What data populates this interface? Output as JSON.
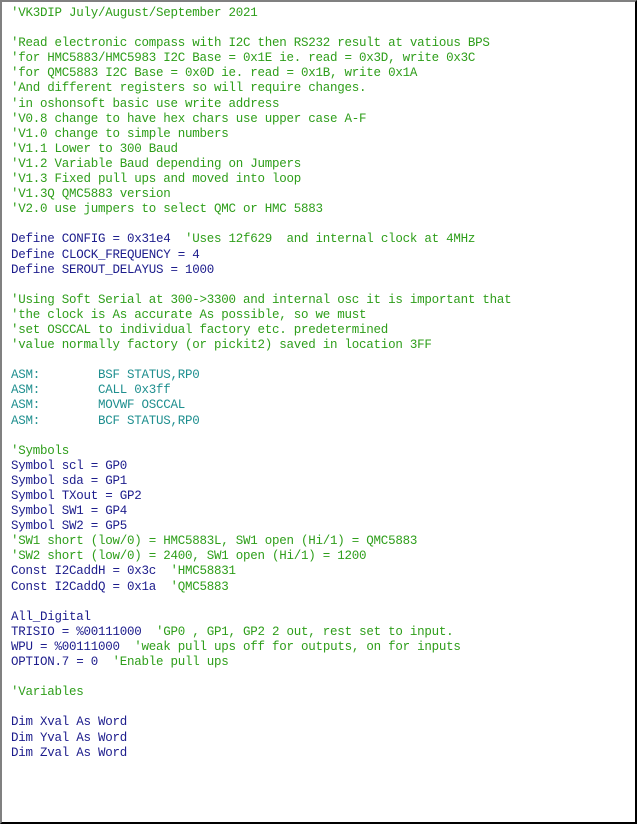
{
  "editor": {
    "colors": {
      "comment": "#2e9e1a",
      "code": "#1c1c8c",
      "asm": "#1f8f8f",
      "background": "#ffffff"
    },
    "lines": [
      [
        {
          "t": "comment",
          "v": "'VK3DIP July/August/September 2021"
        }
      ],
      [],
      [
        {
          "t": "comment",
          "v": "'Read electronic compass with I2C then RS232 result at vatious BPS"
        }
      ],
      [
        {
          "t": "comment",
          "v": "'for HMC5883/HMC5983 I2C Base = 0x1E ie. read = 0x3D, write 0x3C"
        }
      ],
      [
        {
          "t": "comment",
          "v": "'for QMC5883 I2C Base = 0x0D ie. read = 0x1B, write 0x1A"
        }
      ],
      [
        {
          "t": "comment",
          "v": "'And different registers so will require changes."
        }
      ],
      [
        {
          "t": "comment",
          "v": "'in oshonsoft basic use write address"
        }
      ],
      [
        {
          "t": "comment",
          "v": "'V0.8 change to have hex chars use upper case A-F"
        }
      ],
      [
        {
          "t": "comment",
          "v": "'V1.0 change to simple numbers"
        }
      ],
      [
        {
          "t": "comment",
          "v": "'V1.1 Lower to 300 Baud"
        }
      ],
      [
        {
          "t": "comment",
          "v": "'V1.2 Variable Baud depending on Jumpers"
        }
      ],
      [
        {
          "t": "comment",
          "v": "'V1.3 Fixed pull ups and moved into loop"
        }
      ],
      [
        {
          "t": "comment",
          "v": "'V1.3Q QMC5883 version"
        }
      ],
      [
        {
          "t": "comment",
          "v": "'V2.0 use jumpers to select QMC or HMC 5883"
        }
      ],
      [],
      [
        {
          "t": "code",
          "v": "Define CONFIG = 0x31e4  "
        },
        {
          "t": "comment",
          "v": "'Uses 12f629  and internal clock at 4MHz"
        }
      ],
      [
        {
          "t": "code",
          "v": "Define CLOCK_FREQUENCY = 4"
        }
      ],
      [
        {
          "t": "code",
          "v": "Define SEROUT_DELAYUS = 1000"
        }
      ],
      [],
      [
        {
          "t": "comment",
          "v": "'Using Soft Serial at 300->3300 and internal osc it is important that"
        }
      ],
      [
        {
          "t": "comment",
          "v": "'the clock is As accurate As possible, so we must"
        }
      ],
      [
        {
          "t": "comment",
          "v": "'set OSCCAL to individual factory etc. predetermined"
        }
      ],
      [
        {
          "t": "comment",
          "v": "'value normally factory (or pickit2) saved in location 3FF"
        }
      ],
      [],
      [
        {
          "t": "asm",
          "v": "ASM:        BSF STATUS,RP0"
        }
      ],
      [
        {
          "t": "asm",
          "v": "ASM:        CALL 0x3ff"
        }
      ],
      [
        {
          "t": "asm",
          "v": "ASM:        MOVWF OSCCAL"
        }
      ],
      [
        {
          "t": "asm",
          "v": "ASM:        BCF STATUS,RP0"
        }
      ],
      [],
      [
        {
          "t": "comment",
          "v": "'Symbols"
        }
      ],
      [
        {
          "t": "code",
          "v": "Symbol scl = GP0"
        }
      ],
      [
        {
          "t": "code",
          "v": "Symbol sda = GP1"
        }
      ],
      [
        {
          "t": "code",
          "v": "Symbol TXout = GP2"
        }
      ],
      [
        {
          "t": "code",
          "v": "Symbol SW1 = GP4"
        }
      ],
      [
        {
          "t": "code",
          "v": "Symbol SW2 = GP5"
        }
      ],
      [
        {
          "t": "comment",
          "v": "'SW1 short (low/0) = HMC5883L, SW1 open (Hi/1) = QMC5883"
        }
      ],
      [
        {
          "t": "comment",
          "v": "'SW2 short (low/0) = 2400, SW1 open (Hi/1) = 1200"
        }
      ],
      [
        {
          "t": "code",
          "v": "Const I2CaddH = 0x3c  "
        },
        {
          "t": "comment",
          "v": "'HMC58831"
        }
      ],
      [
        {
          "t": "code",
          "v": "Const I2CaddQ = 0x1a  "
        },
        {
          "t": "comment",
          "v": "'QMC5883"
        }
      ],
      [],
      [
        {
          "t": "code",
          "v": "All_Digital"
        }
      ],
      [
        {
          "t": "code",
          "v": "TRISIO = %00111000  "
        },
        {
          "t": "comment",
          "v": "'GP0 , GP1, GP2 2 out, rest set to input."
        }
      ],
      [
        {
          "t": "code",
          "v": "WPU = %00111000  "
        },
        {
          "t": "comment",
          "v": "'weak pull ups off for outputs, on for inputs"
        }
      ],
      [
        {
          "t": "code",
          "v": "OPTION.7 = 0  "
        },
        {
          "t": "comment",
          "v": "'Enable pull ups"
        }
      ],
      [],
      [
        {
          "t": "comment",
          "v": "'Variables"
        }
      ],
      [],
      [
        {
          "t": "code",
          "v": "Dim Xval As Word"
        }
      ],
      [
        {
          "t": "code",
          "v": "Dim Yval As Word"
        }
      ],
      [
        {
          "t": "code",
          "v": "Dim Zval As Word"
        }
      ]
    ]
  }
}
